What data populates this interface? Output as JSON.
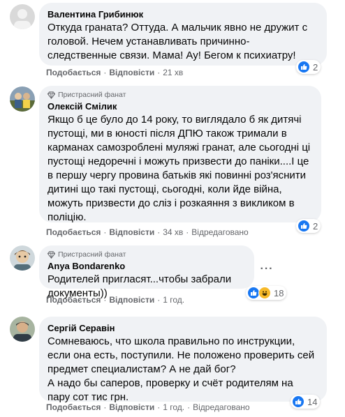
{
  "comments": [
    {
      "author": "Валентина Грибинюк",
      "fan_badge": "",
      "text": "Откуда граната? Оттуда. А мальчик явно не дружит с\nголовой. Нечем устанавливать причинно-\nследственные связи. Мама! Ау! Бегом к психиатру!",
      "like_label": "Подобається",
      "reply_label": "Відповісти",
      "time": "21 хв",
      "edited": "",
      "reaction_count": "2",
      "reactions": [
        "like"
      ]
    },
    {
      "author": "Олексій Смілик",
      "fan_badge": "Пристрасний фанат",
      "text": "Якщо б це було до 14 року, то виглядало б як дитячі\nпустощі, ми в юності після ДПЮ також тримали в\nкарманах самозроблені муляжі гранат, але сьогодні ці\nпустощі недоречні і можуть призвести до паніки....І це\nв першу чергу провина батьків які повинні роз'яснити\nдитині що такі пустощі, сьогодні, коли йде війна,\nможуть призвести до сліз і розкаяння з викликом в\nполіцію.",
      "like_label": "Подобається",
      "reply_label": "Відповісти",
      "time": "34 хв",
      "edited": "Відредаговано",
      "reaction_count": "2",
      "reactions": [
        "like"
      ]
    },
    {
      "author": "Anya  Bondarenko",
      "fan_badge": "Пристрасний фанат",
      "text": "Родителей пригласят...чтобы забрали документы))",
      "like_label": "Подобається",
      "reply_label": "Відповісти",
      "time": "1 год.",
      "edited": "",
      "reaction_count": "18",
      "reactions": [
        "like",
        "haha"
      ]
    },
    {
      "author": "Сергій Серавін",
      "fan_badge": "",
      "text": "Сомневаюсь, что школа правильно по инструкции,\nесли она есть, поступили. Не положено проверить сей\nпредмет специалистам? А не дай бог?\nА надо бы саперов, проверку и счёт родителям на\nпару сот тис грн.",
      "like_label": "Подобається",
      "reply_label": "Відповісти",
      "time": "1 год.",
      "edited": "Відредаговано",
      "reaction_count": "14",
      "reactions": [
        "like"
      ]
    }
  ],
  "colors": {
    "bubble": "#f0f2f5",
    "like_blue": "#1877f2",
    "haha_yellow": "#f7b928",
    "secondary_text": "#65676b"
  },
  "icons": [
    "like-icon",
    "haha-icon",
    "diamond-icon",
    "more-options-icon"
  ]
}
